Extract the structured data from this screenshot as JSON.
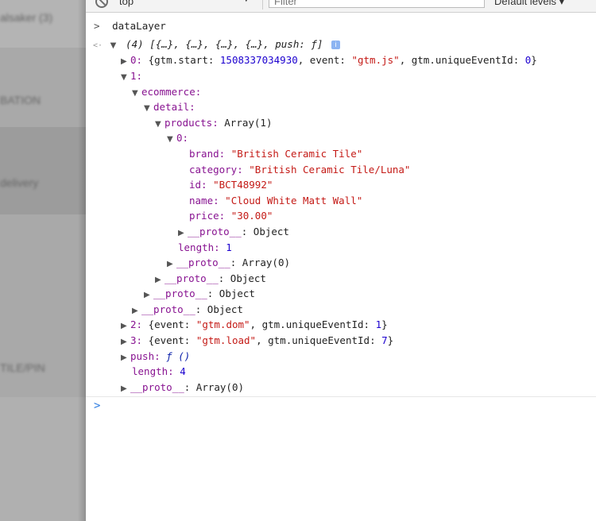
{
  "background": {
    "snippets": [
      "alsaker (3)",
      "BATION",
      "delivery",
      "TILE/PIN"
    ]
  },
  "toolbar": {
    "context": "top",
    "filter_placeholder": "Filter",
    "levels": "Default levels ▾"
  },
  "console": {
    "input_prompt": ">",
    "command": "dataLayer",
    "result_prompt": "<·",
    "summary": "(4) [{…}, {…}, {…}, {…}, push: ƒ]",
    "info_badge": "i",
    "item0": {
      "index": "0:",
      "prefix": "{gtm.start: ",
      "start": "1508337034930",
      "sep1": ", event: ",
      "event": "\"gtm.js\"",
      "sep2": ", gtm.uniqueEventId: ",
      "uid": "0",
      "suffix": "}"
    },
    "item1": {
      "index": "1:",
      "ecommerce": "ecommerce:",
      "detail": "detail:",
      "products_key": "products:",
      "products_val": "Array(1)",
      "product_index": "0:",
      "brand_key": "brand:",
      "brand": "\"British Ceramic Tile\"",
      "category_key": "category:",
      "category": "\"British Ceramic Tile/Luna\"",
      "id_key": "id:",
      "id": "\"BCT48992\"",
      "name_key": "name:",
      "name": "\"Cloud White Matt Wall\"",
      "price_key": "price:",
      "price": "\"30.00\"",
      "proto_key": "__proto__",
      "proto_object": "Object",
      "length_key": "length:",
      "length": "1",
      "proto_array": "Array(0)"
    },
    "item2": {
      "index": "2:",
      "prefix": "{event: ",
      "event": "\"gtm.dom\"",
      "sep": ", gtm.uniqueEventId: ",
      "uid": "1",
      "suffix": "}"
    },
    "item3": {
      "index": "3:",
      "prefix": "{event: ",
      "event": "\"gtm.load\"",
      "sep": ", gtm.uniqueEventId: ",
      "uid": "7",
      "suffix": "}"
    },
    "push_key": "push:",
    "push_val": "ƒ ()",
    "length_key": "length:",
    "length": "4",
    "proto_key": "__proto__",
    "proto_val": "Array(0)",
    "caret": ">"
  }
}
